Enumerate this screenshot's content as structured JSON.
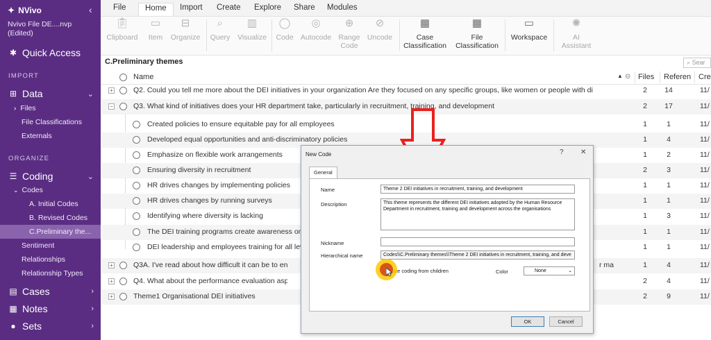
{
  "sidebar": {
    "app_name": "NVivo",
    "collapse_icon": "chevron-left",
    "file_name": "Nvivo File DE....nvp (Edited)",
    "quick_access": "Quick Access",
    "import_section": "IMPORT",
    "data": "Data",
    "files": "Files",
    "file_classifications": "File Classifications",
    "externals": "Externals",
    "organize_section": "ORGANIZE",
    "coding": "Coding",
    "codes": "Codes",
    "initial_codes": "A. Initial Codes",
    "revised_codes": "B. Revised Codes",
    "preliminary": "C.Preliminary the...",
    "sentiment": "Sentiment",
    "relationships": "Relationships",
    "relationship_types": "Relationship Types",
    "cases": "Cases",
    "notes": "Notes",
    "sets": "Sets"
  },
  "tabs": [
    "File",
    "Home",
    "Import",
    "Create",
    "Explore",
    "Share",
    "Modules"
  ],
  "active_tab": "Home",
  "ribbon": {
    "clipboard": "Clipboard",
    "item": "Item",
    "organize": "Organize",
    "query": "Query",
    "visualize": "Visualize",
    "code": "Code",
    "autocode": "Autocode",
    "range_code_1": "Range",
    "range_code_2": "Code",
    "uncode": "Uncode",
    "case_class_1": "Case",
    "case_class_2": "Classification",
    "file_class_1": "File",
    "file_class_2": "Classification",
    "workspace": "Workspace",
    "ai_1": "AI",
    "ai_2": "Assistant"
  },
  "list": {
    "title": "C.Preliminary themes",
    "search_placeholder": "Sear",
    "col_name": "Name",
    "col_files": "Files",
    "col_references": "Referen",
    "col_created": "Crea",
    "rows": [
      {
        "name": "Q2. Could you tell me more about the DEI initiatives in your organization Are they focused on any specific groups, like women or people with di",
        "files": "2",
        "refs": "14",
        "created": "11/"
      },
      {
        "name": "Q3. What kind of initiatives does your HR department take, particularly in recruitment, training, and development",
        "files": "2",
        "refs": "17",
        "created": "11/"
      },
      {
        "name": "Created policies to ensure equitable pay for all employees",
        "files": "1",
        "refs": "1",
        "created": "11/"
      },
      {
        "name": "Developed equal opportunities and anti-discriminatory policies",
        "files": "1",
        "refs": "4",
        "created": "11/"
      },
      {
        "name": "Emphasize on flexible work arrangements",
        "files": "1",
        "refs": "2",
        "created": "11/"
      },
      {
        "name": "Ensuring diversity in recruitment",
        "files": "2",
        "refs": "3",
        "created": "11/"
      },
      {
        "name": "HR drives changes by implementing policies",
        "files": "1",
        "refs": "1",
        "created": "11/"
      },
      {
        "name": "HR drives changes by running surveys",
        "files": "1",
        "refs": "1",
        "created": "11/"
      },
      {
        "name": "Identifying where diversity is lacking",
        "files": "1",
        "refs": "3",
        "created": "11/"
      },
      {
        "name": "The DEI training programs create awareness on",
        "files": "1",
        "refs": "1",
        "created": "11/"
      },
      {
        "name": "DEI leadership and employees training for all lev",
        "files": "1",
        "refs": "1",
        "created": "11/"
      },
      {
        "name": "Q3A. I've read about how difficult it can be to ensu",
        "name_tail": "r ma",
        "files": "1",
        "refs": "4",
        "created": "11/"
      },
      {
        "name": "Q4. What about the performance evaluation aspect",
        "files": "2",
        "refs": "4",
        "created": "11/"
      },
      {
        "name": "Theme1 Organisational DEI initiatives",
        "files": "2",
        "refs": "9",
        "created": "11/"
      }
    ]
  },
  "dialog": {
    "title": "New Code",
    "help": "?",
    "close": "✕",
    "tab_general": "General",
    "name_label": "Name",
    "name_value": "Theme 2 DEI initiatives in recruitment, training, and development",
    "description_label": "Description",
    "description_value": "This theme represents the different DEI initiatives adopted by the Human Resource Department in recruitment, training and development across the organisations",
    "nickname_label": "Nickname",
    "nickname_value": "",
    "hier_label": "Hierarchical name",
    "hier_value": "Codes\\\\C.Preliminary themes\\\\Theme 2 DEI initiatives in recruitment, training, and deve",
    "aggregate_label": "regate coding from children",
    "color_label": "Color",
    "color_value": "None",
    "ok": "OK",
    "cancel": "Cancel"
  },
  "colors": {
    "sidebar": "#5a2d82",
    "sidebar_active": "#8a63ad",
    "arrow": "#e8211e",
    "cursor_highlight": "#ffc800"
  }
}
